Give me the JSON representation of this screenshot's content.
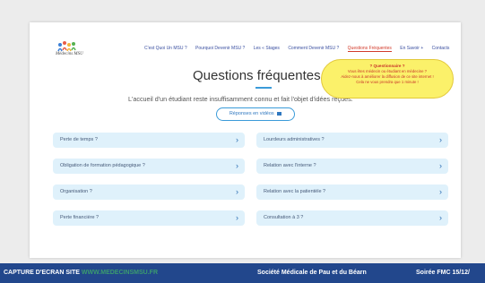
{
  "brand": {
    "logo_text": "Médecins MSU",
    "logo_colors": [
      "#3b7fd6",
      "#e85d4a",
      "#f3b63c",
      "#55b24f"
    ]
  },
  "nav": {
    "items": [
      "C'est Quoi Un MSU ?",
      "Pourquoi Devenir MSU ?",
      "Les « Stages",
      "Comment Devenir MSU ?",
      "Questions Fréquentes",
      "En Savoir +",
      "Contacts"
    ],
    "active_index": 4
  },
  "main": {
    "title": "Questions fréquentes",
    "intro": "L'accueil d'un étudiant reste insuffisamment connu et fait l'objet d'idées reçues.",
    "video_button": "Réponses en vidéos"
  },
  "survey": {
    "title": "? Questionnaire ?",
    "line1": "Vous êtes médecin ou étudiant en médecine ?",
    "line2": "Aidez-nous à améliorer la diffusion de ce site internet !",
    "line3": "Cela ne vous prendra que 1 minute !"
  },
  "faq": {
    "left": [
      "Perte de temps ?",
      "Obligation de formation pédagogique ?",
      "Organisation ?",
      "Perte financière ?"
    ],
    "right": [
      "Lourdeurs administratives ?",
      "Relation avec l'interne ?",
      "Relation avec la patientèle ?",
      "Consultation à 3 ?"
    ],
    "chevron": "›"
  },
  "footer": {
    "capture_label": "CAPTURE D'ECRAN SITE",
    "url": "WWW.MEDECINSMSU.FR",
    "society": "Société Médicale de Pau et du Béarn",
    "event": "Soirée FMC 15/12/"
  },
  "colors": {
    "accent": "#3a9bd9",
    "active_nav": "#d23b2b",
    "faq_bg": "#dff1fb",
    "footer_bg": "#22478c"
  }
}
